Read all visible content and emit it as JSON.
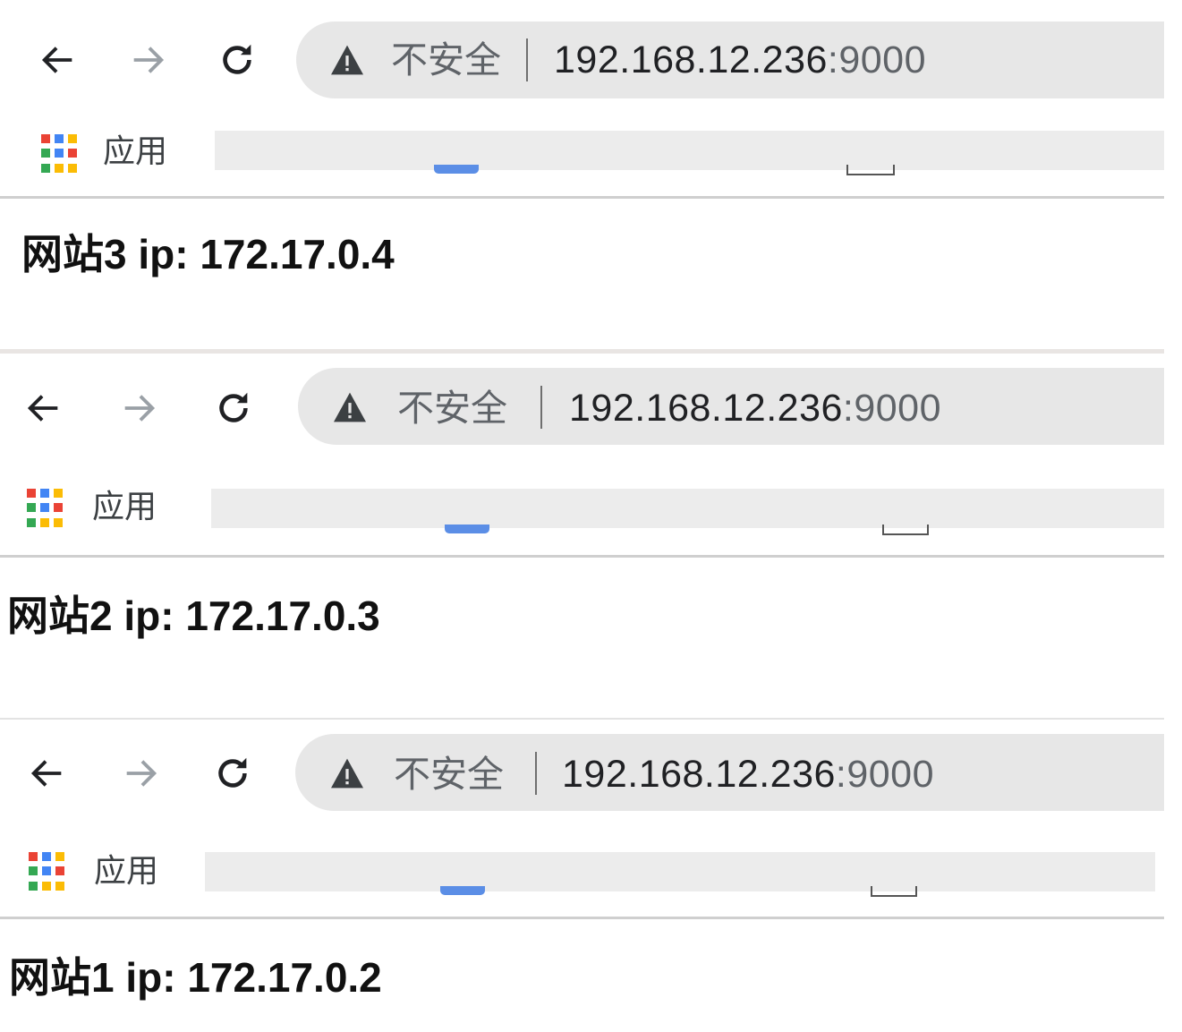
{
  "windows": [
    {
      "security_label": "不安全",
      "url_host": "192.168.12.236",
      "url_port": ":9000",
      "bookmarks_apps_label": "应用",
      "page_heading": "网站3 ip: 172.17.0.4"
    },
    {
      "security_label": "不安全",
      "url_host": "192.168.12.236",
      "url_port": ":9000",
      "bookmarks_apps_label": "应用",
      "page_heading": "网站2 ip: 172.17.0.3"
    },
    {
      "security_label": "不安全",
      "url_host": "192.168.12.236",
      "url_port": ":9000",
      "bookmarks_apps_label": "应用",
      "page_heading": "网站1 ip: 172.17.0.2"
    }
  ],
  "icons": {
    "back": "arrow-left-icon",
    "forward": "arrow-right-icon",
    "reload": "reload-icon",
    "warning": "warning-triangle-icon",
    "apps": "apps-grid-icon"
  },
  "colors": {
    "omnibox_bg": "#e7e7e7",
    "apps_grid": [
      "#ea4335",
      "#4285f4",
      "#fbbc05",
      "#34a853"
    ]
  }
}
